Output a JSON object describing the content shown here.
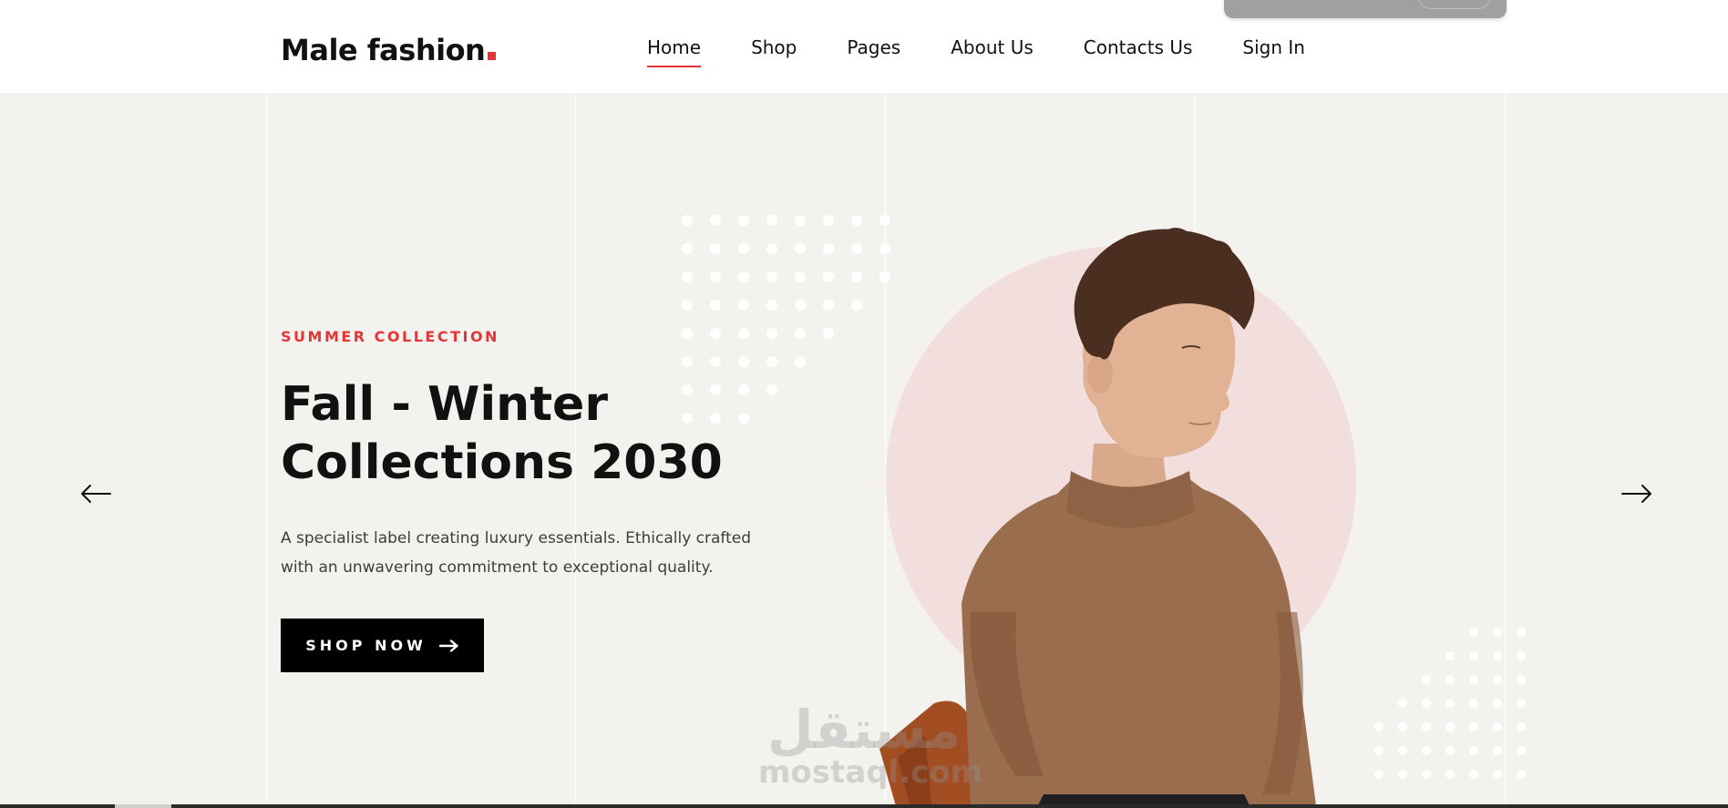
{
  "header": {
    "logo_text": "Male fashion",
    "nav": [
      {
        "label": "Home",
        "active": true
      },
      {
        "label": "Shop",
        "active": false
      },
      {
        "label": "Pages",
        "active": false
      },
      {
        "label": "About Us",
        "active": false
      },
      {
        "label": "Contacts Us",
        "active": false
      },
      {
        "label": "Sign In",
        "active": false
      }
    ]
  },
  "hero": {
    "subtitle": "SUMMER COLLECTION",
    "title_line1": "Fall - Winter",
    "title_line2": "Collections 2030",
    "description_line1": "A specialist label creating luxury essentials. Ethically crafted",
    "description_line2": "with an unwavering commitment to exceptional quality.",
    "button_label": "SHOP NOW",
    "button_icon": "arrow-right-icon",
    "prev_icon": "arrow-left-icon",
    "next_icon": "arrow-right-icon"
  },
  "watermark": {
    "arabic": "مستقل",
    "latin": "mostaql.com"
  },
  "colors": {
    "accent": "#e53637",
    "hero_bg": "#f3f2ee",
    "circle": "#f1dedd",
    "text": "#111111",
    "sweater": "#9a6d4e"
  }
}
